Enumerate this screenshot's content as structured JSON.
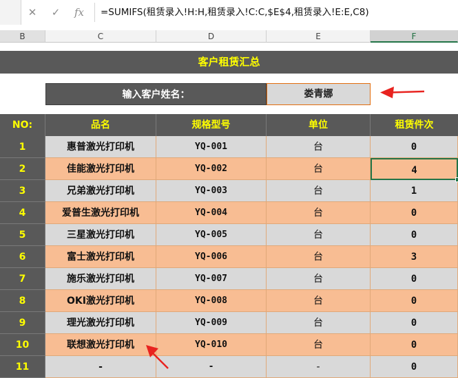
{
  "formula_bar": {
    "cancel_icon": "close-icon",
    "confirm_icon": "check-icon",
    "fx_label": "fx",
    "formula": "=SUMIFS(租赁录入!H:H,租赁录入!C:C,$E$4,租赁录入!E:E,C8)"
  },
  "columns": [
    "B",
    "C",
    "D",
    "E",
    "F"
  ],
  "selected_column": "F",
  "title": "客户租赁汇总",
  "customer_input": {
    "label": "输入客户姓名：",
    "value": "娄青娜"
  },
  "table": {
    "headers": {
      "no": "NO:",
      "name": "品名",
      "model": "规格型号",
      "unit": "单位",
      "count": "租赁件次"
    },
    "rows": [
      {
        "no": "1",
        "name": "惠普激光打印机",
        "model": "YQ-001",
        "unit": "台",
        "count": "0"
      },
      {
        "no": "2",
        "name": "佳能激光打印机",
        "model": "YQ-002",
        "unit": "台",
        "count": "4"
      },
      {
        "no": "3",
        "name": "兄弟激光打印机",
        "model": "YQ-003",
        "unit": "台",
        "count": "1"
      },
      {
        "no": "4",
        "name": "爱普生激光打印机",
        "model": "YQ-004",
        "unit": "台",
        "count": "0"
      },
      {
        "no": "5",
        "name": "三星激光打印机",
        "model": "YQ-005",
        "unit": "台",
        "count": "0"
      },
      {
        "no": "6",
        "name": "富士激光打印机",
        "model": "YQ-006",
        "unit": "台",
        "count": "3"
      },
      {
        "no": "7",
        "name": "施乐激光打印机",
        "model": "YQ-007",
        "unit": "台",
        "count": "0"
      },
      {
        "no": "8",
        "name": "OKI激光打印机",
        "model": "YQ-008",
        "unit": "台",
        "count": "0"
      },
      {
        "no": "9",
        "name": "理光激光打印机",
        "model": "YQ-009",
        "unit": "台",
        "count": "0"
      },
      {
        "no": "10",
        "name": "联想激光打印机",
        "model": "YQ-010",
        "unit": "台",
        "count": "0"
      },
      {
        "no": "11",
        "name": "-",
        "model": "-",
        "unit": "-",
        "count": "0"
      }
    ]
  },
  "colors": {
    "header_dark": "#595959",
    "header_text": "#ffff00",
    "row_gray": "#d9d9d9",
    "row_orange": "#f8bd93",
    "annotation_red": "#e8231f",
    "selection_green": "#217346"
  }
}
